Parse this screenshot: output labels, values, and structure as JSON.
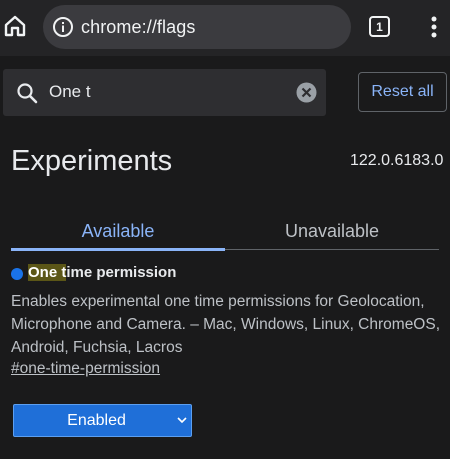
{
  "browser": {
    "url": "chrome://flags",
    "tab_count": "1",
    "icons": [
      "home-icon",
      "info-icon",
      "tab-switcher-icon",
      "more-vert-icon"
    ]
  },
  "search": {
    "value": "One t",
    "icons": [
      "search-icon",
      "clear-icon"
    ]
  },
  "reset_all_label": "Reset all",
  "header": {
    "title": "Experiments",
    "version": "122.0.6183.0"
  },
  "tabs": [
    {
      "label": "Available",
      "active": true
    },
    {
      "label": "Unavailable",
      "active": false
    }
  ],
  "experiment": {
    "title_highlight": "One t",
    "title_rest": "ime permission",
    "description": "Enables experimental one time permissions for Geolocation, Microphone and Camera. – Mac, Windows, Linux, ChromeOS, Android, Fuchsia, Lacros",
    "link": "#one-time-permission",
    "selected_option": "Enabled"
  },
  "colors": {
    "background": "#1a1a1b",
    "accent": "#8ab4f8",
    "select_bg": "#1f6fd8",
    "highlight": "#5b5617"
  }
}
